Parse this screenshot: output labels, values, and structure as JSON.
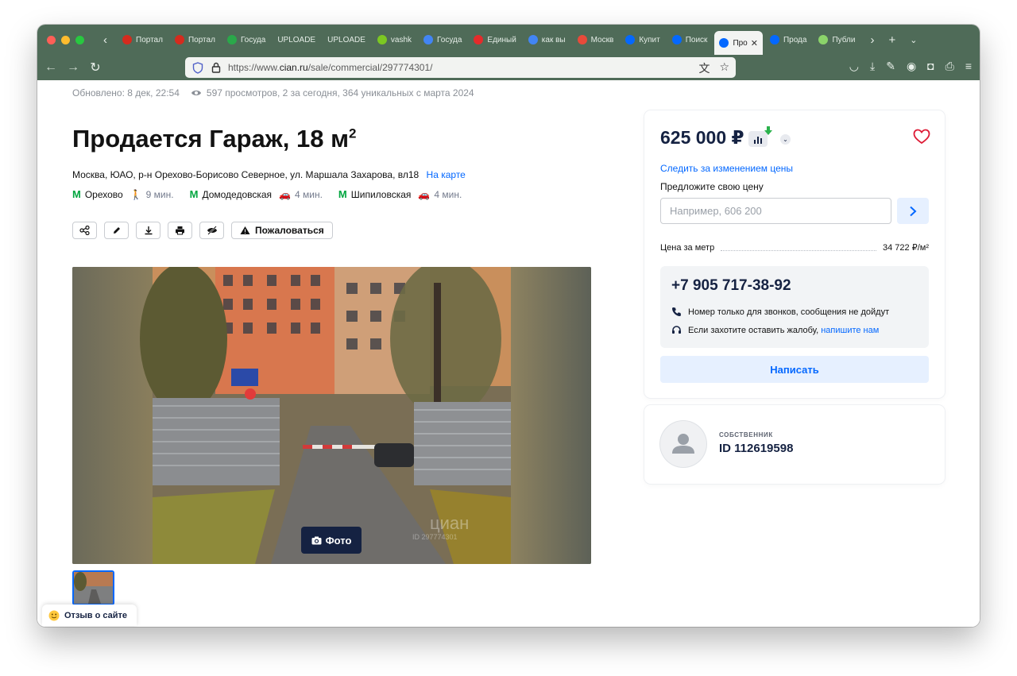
{
  "browser": {
    "tabs": [
      {
        "label": "Портал",
        "favicon_color": "#d52b1e"
      },
      {
        "label": "Портал",
        "favicon_color": "#d52b1e"
      },
      {
        "label": "Госуда",
        "favicon_color": "#2aa84a"
      },
      {
        "label": "UPLOADE",
        "favicon_color": ""
      },
      {
        "label": "UPLOADE",
        "favicon_color": ""
      },
      {
        "label": "vashk",
        "favicon_color": "#7cc822"
      },
      {
        "label": "Госуда",
        "favicon_color": "#4285f4"
      },
      {
        "label": "Единый",
        "favicon_color": "#e52b2b"
      },
      {
        "label": "как вы",
        "favicon_color": "#4285f4"
      },
      {
        "label": "Москв",
        "favicon_color": "#e84a3a"
      },
      {
        "label": "Купит",
        "favicon_color": "#0468ff"
      },
      {
        "label": "Поиск",
        "favicon_color": "#0468ff"
      },
      {
        "label": "Про",
        "favicon_color": "#0468ff",
        "active": true
      },
      {
        "label": "Прода",
        "favicon_color": "#0468ff"
      },
      {
        "label": "Публи",
        "favicon_color": "#8bd36a"
      }
    ],
    "url_prefix": "https://www.",
    "url_domain": "cian.ru",
    "url_path": "/sale/commercial/297774301/"
  },
  "listing": {
    "updated": "Обновлено: 8 дек, 22:54",
    "views": "597 просмотров, 2 за сегодня, 364 уникальных с марта 2024",
    "title": "Продается Гараж, 18 м",
    "title_sup": "2",
    "address": "Москва, ЮАО, р-н Орехово-Борисово Северное, ул. Маршала Захарова, вл18",
    "map_link": "На карте",
    "metro": [
      {
        "name": "Орехово",
        "time": "9 мин.",
        "mode": "walk"
      },
      {
        "name": "Домодедовская",
        "time": "4 мин.",
        "mode": "car"
      },
      {
        "name": "Шипиловская",
        "time": "4 мин.",
        "mode": "car"
      }
    ],
    "report_label": "Пожаловаться",
    "photo_label": "Фото",
    "watermark": "циан",
    "watermark_id": "ID 297774301"
  },
  "sidebar": {
    "price": "625 000 ₽",
    "follow_price": "Следить за изменением цены",
    "offer_label": "Предложите свою цену",
    "offer_placeholder": "Например, 606 200",
    "price_per_meter_label": "Цена за метр",
    "price_per_meter_value": "34 722 ₽/м²",
    "phone": "+7 905 717-38-92",
    "phone_note": "Номер только для звонков, сообщения не дойдут",
    "complaint_text": "Если захотите оставить жалобу,",
    "complaint_link": "напишите нам",
    "write_button": "Написать",
    "owner_role": "СОБСТВЕННИК",
    "owner_id": "ID 112619598"
  },
  "feedback": {
    "label": "Отзыв о сайте"
  },
  "colors": {
    "accent": "#0468ff",
    "metro": "#00a63f",
    "dark": "#152242",
    "heart": "#de1a35"
  }
}
